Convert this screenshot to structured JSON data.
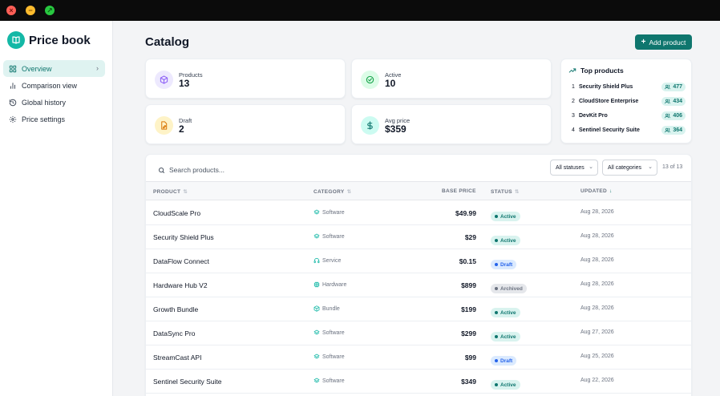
{
  "app": {
    "name": "Price book",
    "colors": {
      "accent": "#0f766e",
      "accent_light": "#dff3f1",
      "logo": "#14b8a6"
    }
  },
  "window_controls": {
    "close": "×",
    "minimize": "−",
    "maximize": "↗"
  },
  "sidebar": {
    "items": [
      {
        "label": "Overview",
        "icon": "grid-icon",
        "active": true
      },
      {
        "label": "Comparison view",
        "icon": "bar-chart-icon",
        "active": false
      },
      {
        "label": "Global history",
        "icon": "history-icon",
        "active": false
      },
      {
        "label": "Price settings",
        "icon": "gear-icon",
        "active": false
      }
    ]
  },
  "header": {
    "title": "Catalog",
    "add_button": "Add product"
  },
  "stats": [
    {
      "label": "Products",
      "value": "13",
      "icon": "cube-icon",
      "color": "#8b5cf6",
      "bg": "#ede9fe"
    },
    {
      "label": "Active",
      "value": "10",
      "icon": "check-circle-icon",
      "color": "#16a34a",
      "bg": "#dcfce7"
    },
    {
      "label": "Draft",
      "value": "2",
      "icon": "edit-doc-icon",
      "color": "#d97706",
      "bg": "#fef3c7"
    },
    {
      "label": "Avg price",
      "value": "$359",
      "icon": "dollar-icon",
      "color": "#0f766e",
      "bg": "#ccfbf1"
    }
  ],
  "top_products": {
    "title": "Top products",
    "items": [
      {
        "rank": "1",
        "name": "Security Shield Plus",
        "count": "477"
      },
      {
        "rank": "2",
        "name": "CloudStore Enterprise",
        "count": "434"
      },
      {
        "rank": "3",
        "name": "DevKit Pro",
        "count": "406"
      },
      {
        "rank": "4",
        "name": "Sentinel Security Suite",
        "count": "364"
      }
    ]
  },
  "toolbar": {
    "search_placeholder": "Search products...",
    "status_filter": "All statuses",
    "category_filter": "All categories",
    "result_count": "13 of 13"
  },
  "table": {
    "columns": {
      "product": "PRODUCT",
      "category": "CATEGORY",
      "base_price": "BASE PRICE",
      "status": "STATUS",
      "updated": "UPDATED"
    },
    "status_colors": {
      "Active": {
        "fg": "#0f766e",
        "bg": "#d9f3ef"
      },
      "Draft": {
        "fg": "#2563eb",
        "bg": "#dbeafe"
      },
      "Archived": {
        "fg": "#6b7280",
        "bg": "#e5e7eb"
      }
    },
    "rows": [
      {
        "name": "CloudScale Pro",
        "category": "Software",
        "price": "$49.99",
        "status": "Active",
        "updated": "Aug 28, 2026"
      },
      {
        "name": "Security Shield Plus",
        "category": "Software",
        "price": "$29",
        "status": "Active",
        "updated": "Aug 28, 2026"
      },
      {
        "name": "DataFlow Connect",
        "category": "Service",
        "price": "$0.15",
        "status": "Draft",
        "updated": "Aug 28, 2026"
      },
      {
        "name": "Hardware Hub V2",
        "category": "Hardware",
        "price": "$899",
        "status": "Archived",
        "updated": "Aug 28, 2026"
      },
      {
        "name": "Growth Bundle",
        "category": "Bundle",
        "price": "$199",
        "status": "Active",
        "updated": "Aug 28, 2026"
      },
      {
        "name": "DataSync Pro",
        "category": "Software",
        "price": "$299",
        "status": "Active",
        "updated": "Aug 27, 2026"
      },
      {
        "name": "StreamCast API",
        "category": "Software",
        "price": "$99",
        "status": "Draft",
        "updated": "Aug 25, 2026"
      },
      {
        "name": "Sentinel Security Suite",
        "category": "Software",
        "price": "$349",
        "status": "Active",
        "updated": "Aug 22, 2026"
      }
    ]
  }
}
